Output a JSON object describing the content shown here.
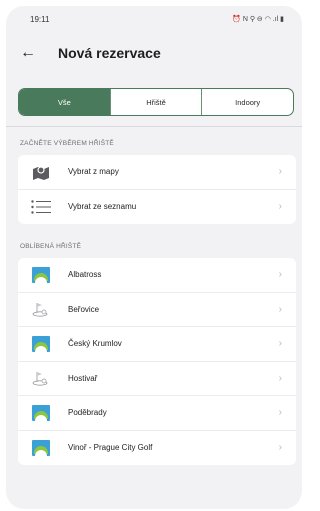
{
  "status_bar": {
    "time": "19:11",
    "icons": "⏰ N ⚲ ⊖ ◠ .ıl ▮"
  },
  "header": {
    "back_icon": "arrow-left-icon",
    "title": "Nová rezervace"
  },
  "tabs": [
    {
      "label": "Vše",
      "active": true
    },
    {
      "label": "Hřiště",
      "active": false
    },
    {
      "label": "Indoory",
      "active": false
    }
  ],
  "section_start": {
    "label": "ZAČNĚTE VÝBĚREM HŘIŠTĚ",
    "items": [
      {
        "label": "Vybrat z mapy",
        "icon": "map-pin-icon"
      },
      {
        "label": "Vybrat ze seznamu",
        "icon": "list-icon"
      }
    ]
  },
  "section_favorites": {
    "label": "OBLÍBENÁ HŘIŠTĚ",
    "items": [
      {
        "label": "Albatross",
        "icon": "club-logo-icon"
      },
      {
        "label": "Beřovice",
        "icon": "golf-ball-icon"
      },
      {
        "label": "Český Krumlov",
        "icon": "club-logo-icon"
      },
      {
        "label": "Hostivař",
        "icon": "golf-ball-icon"
      },
      {
        "label": "Poděbrady",
        "icon": "club-logo-icon"
      },
      {
        "label": "Vinoř - Prague City Golf",
        "icon": "club-logo-icon"
      }
    ]
  },
  "colors": {
    "accent": "#4a7a5c",
    "background": "#f2f2f4",
    "logo_blue": "#3aa0d6",
    "logo_green": "#8dc63f"
  }
}
